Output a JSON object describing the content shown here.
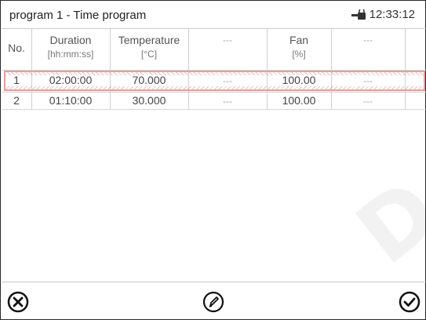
{
  "header": {
    "title": "program 1 - Time program",
    "time": "12:33:12"
  },
  "columns": [
    {
      "label": "No.",
      "unit": ""
    },
    {
      "label": "Duration",
      "unit": "[hh:mm:ss]"
    },
    {
      "label": "Temperature",
      "unit": "[°C]"
    },
    {
      "label": "---",
      "unit": ""
    },
    {
      "label": "Fan",
      "unit": "[%]"
    },
    {
      "label": "---",
      "unit": ""
    }
  ],
  "rows": [
    {
      "no": "1",
      "duration": "02:00:00",
      "temperature": "70.000",
      "c4": "---",
      "fan": "100.00",
      "c6": "---"
    },
    {
      "no": "2",
      "duration": "01:10:00",
      "temperature": "30.000",
      "c4": "---",
      "fan": "100.00",
      "c6": "---"
    }
  ],
  "footer": {
    "cancel_icon": "close-circle-icon",
    "edit_icon": "pencil-circle-icon",
    "confirm_icon": "check-circle-icon"
  },
  "colors": {
    "selection": "#e6a0a0",
    "separator": "#cfcfcf"
  }
}
